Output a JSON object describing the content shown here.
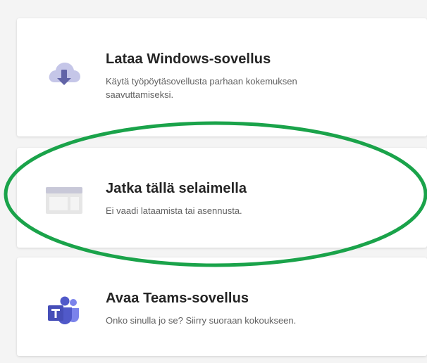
{
  "options": [
    {
      "title": "Lataa Windows-sovellus",
      "description": "Käytä työpöytäsovellusta parhaan kokemuksen saavuttamiseksi.",
      "icon": "cloud-download-icon"
    },
    {
      "title": "Jatka tällä selaimella",
      "description": "Ei vaadi lataamista tai asennusta.",
      "icon": "browser-window-icon"
    },
    {
      "title": "Avaa Teams-sovellus",
      "description": "Onko sinulla jo se? Siirry suoraan kokoukseen.",
      "icon": "teams-logo-icon"
    }
  ],
  "colors": {
    "highlight": "#1aa34a",
    "icon_purple": "#6264a7",
    "icon_light": "#c5c6e8",
    "browser_gray": "#d6d6d6"
  }
}
